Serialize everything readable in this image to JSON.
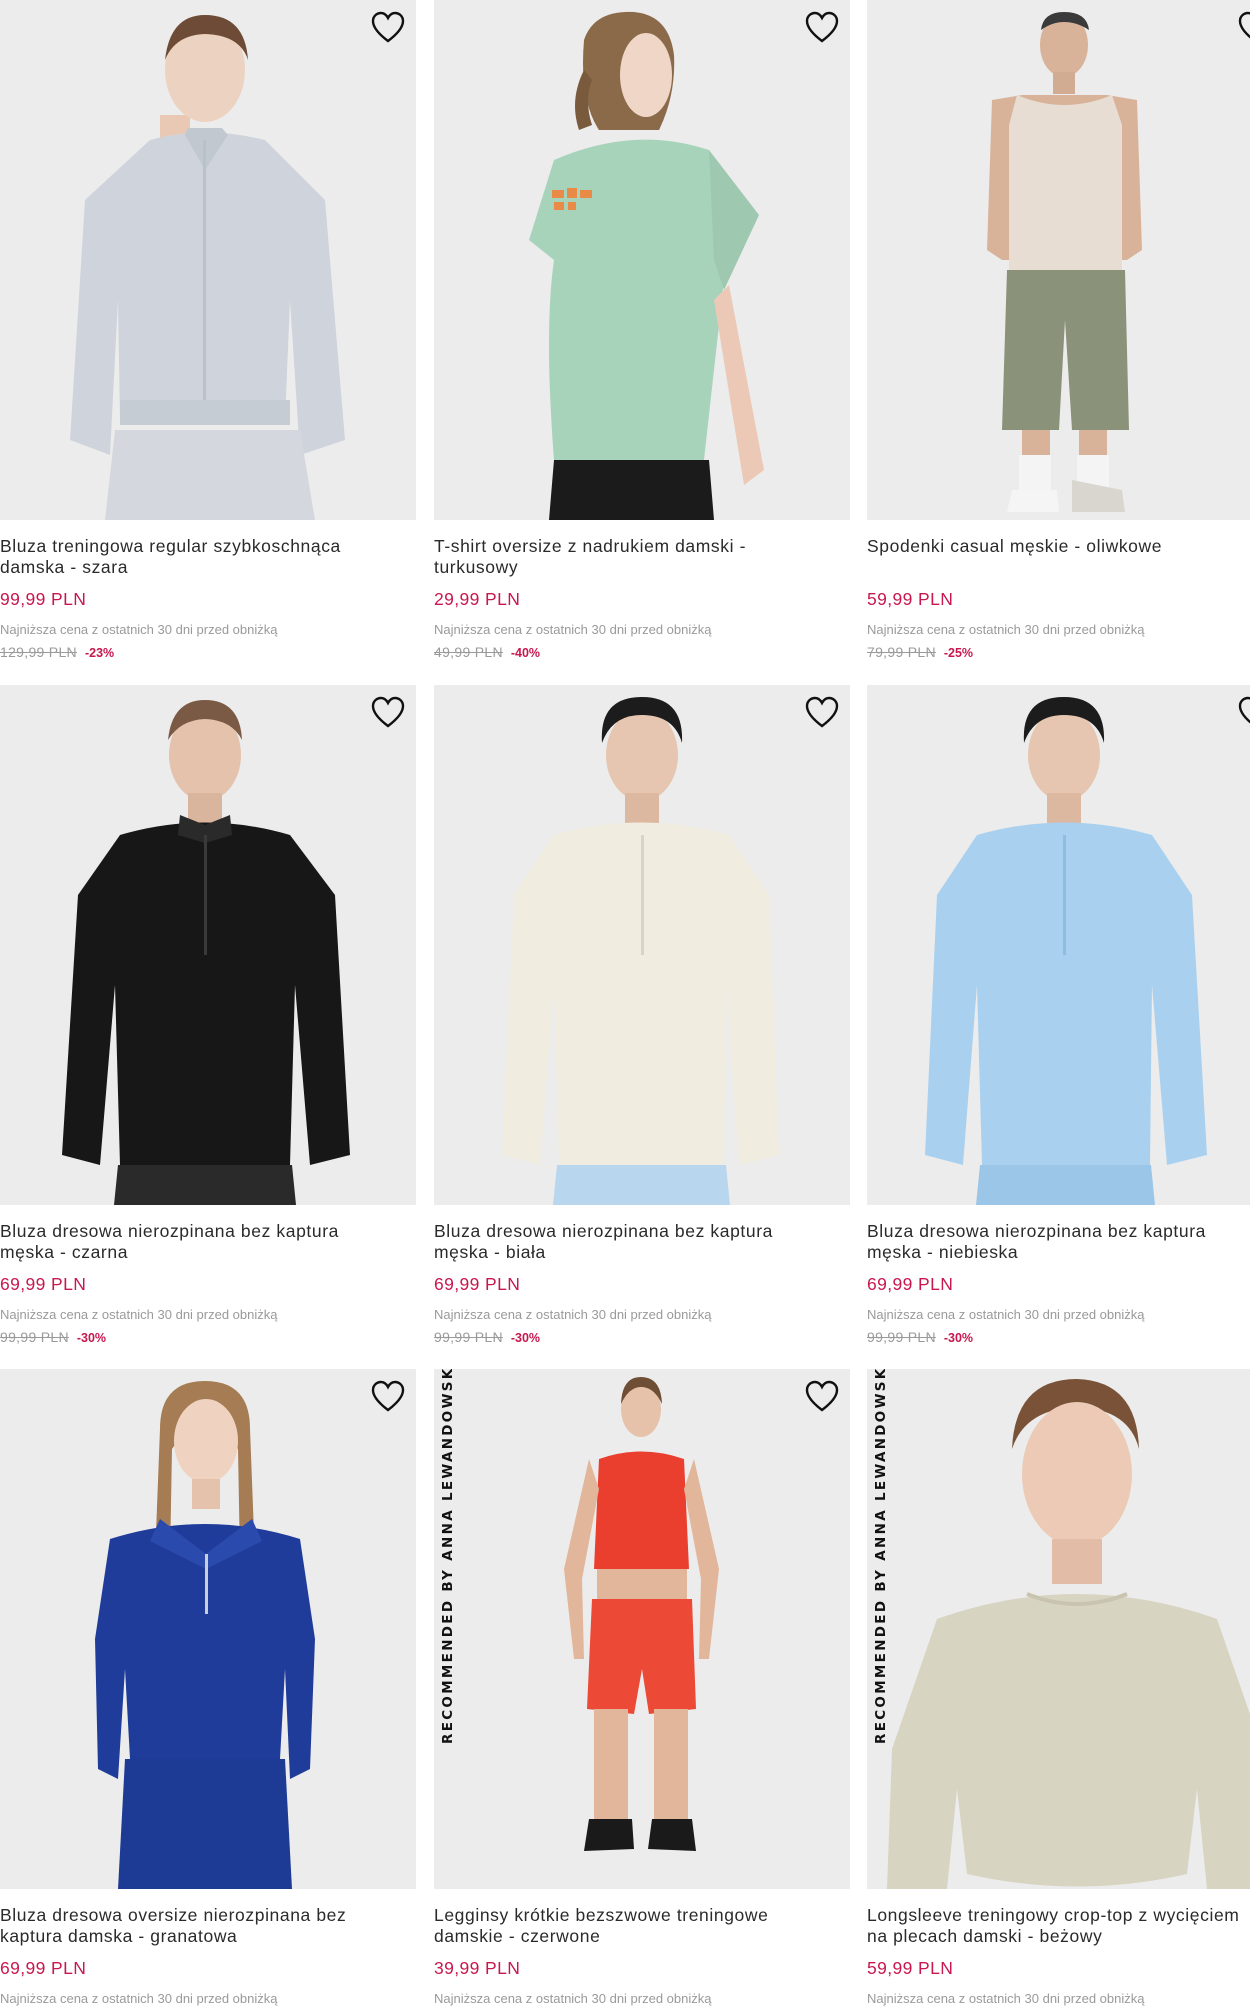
{
  "colors": {
    "sale_price": "#c8174f",
    "discount": "#c8174f",
    "muted": "#9a9a9a",
    "text": "#2a2a2a"
  },
  "products": [
    {
      "name": "Bluza treningowa regular szybkoschnąca\ndamska - szara",
      "price": "99,99 PLN",
      "lowest_note": "Najniższa cena z ostatnich 30 dni przed obniżką",
      "old_price": "129,99 PLN",
      "discount": "-23%",
      "wishlist_icon": "heart-outline-icon",
      "badge": ""
    },
    {
      "name": "T-shirt oversize z nadrukiem damski -\nturkusowy",
      "price": "29,99 PLN",
      "lowest_note": "Najniższa cena z ostatnich 30 dni przed obniżką",
      "old_price": "49,99 PLN",
      "discount": "-40%",
      "wishlist_icon": "heart-outline-icon",
      "badge": ""
    },
    {
      "name": "Spodenki casual męskie - oliwkowe",
      "price": "59,99 PLN",
      "lowest_note": "Najniższa cena z ostatnich 30 dni przed obniżką",
      "old_price": "79,99 PLN",
      "discount": "-25%",
      "wishlist_icon": "heart-outline-icon",
      "badge": ""
    },
    {
      "name": "Bluza dresowa nierozpinana bez kaptura\nmęska - czarna",
      "price": "69,99 PLN",
      "lowest_note": "Najniższa cena z ostatnich 30 dni przed obniżką",
      "old_price": "99,99 PLN",
      "discount": "-30%",
      "wishlist_icon": "heart-outline-icon",
      "badge": ""
    },
    {
      "name": "Bluza dresowa nierozpinana bez kaptura\nmęska - biała",
      "price": "69,99 PLN",
      "lowest_note": "Najniższa cena z ostatnich 30 dni przed obniżką",
      "old_price": "99,99 PLN",
      "discount": "-30%",
      "wishlist_icon": "heart-outline-icon",
      "badge": ""
    },
    {
      "name": "Bluza dresowa nierozpinana bez kaptura\nmęska - niebieska",
      "price": "69,99 PLN",
      "lowest_note": "Najniższa cena z ostatnich 30 dni przed obniżką",
      "old_price": "99,99 PLN",
      "discount": "-30%",
      "wishlist_icon": "heart-outline-icon",
      "badge": ""
    },
    {
      "name": "Bluza dresowa oversize nierozpinana bez\nkaptura damska - granatowa",
      "price": "69,99 PLN",
      "lowest_note": "Najniższa cena z ostatnich 30 dni przed obniżką",
      "old_price": "",
      "discount": "",
      "wishlist_icon": "heart-outline-icon",
      "badge": ""
    },
    {
      "name": "Legginsy krótkie bezszwowe treningowe\ndamskie - czerwone",
      "price": "39,99 PLN",
      "lowest_note": "Najniższa cena z ostatnich 30 dni przed obniżką",
      "old_price": "",
      "discount": "",
      "wishlist_icon": "heart-outline-icon",
      "badge": "RECOMMENDED BY ANNA LEWANDOWSKA"
    },
    {
      "name": "Longsleeve treningowy crop-top z wycięciem\nna plecach damski - beżowy",
      "price": "59,99 PLN",
      "lowest_note": "Najniższa cena z ostatnich 30 dni przed obniżką",
      "old_price": "",
      "discount": "",
      "wishlist_icon": "heart-outline-icon",
      "badge": "RECOMMENDED BY ANNA LEWANDOWSKA"
    }
  ]
}
